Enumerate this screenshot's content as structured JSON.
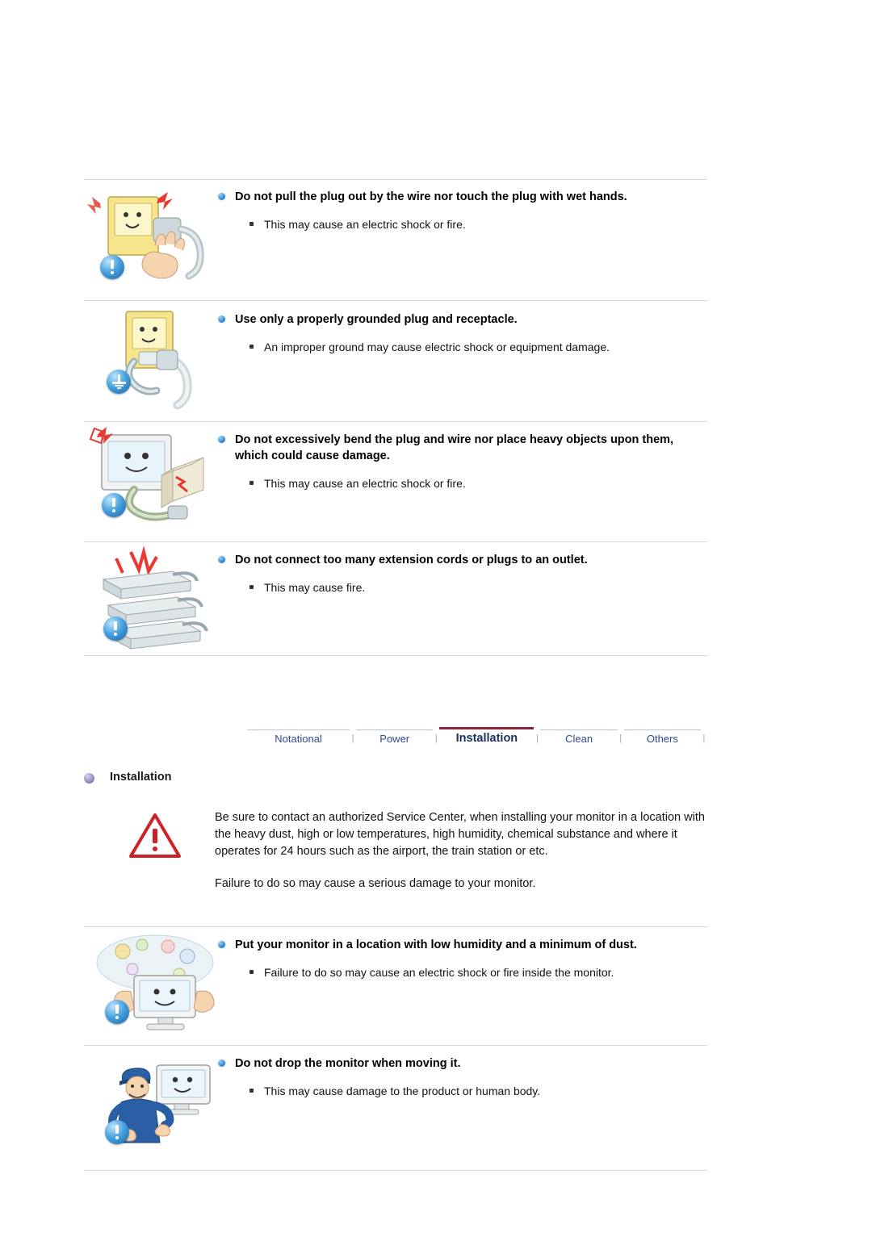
{
  "document": {
    "title": "Safety Instructions - Power / Installation",
    "icons": {
      "warning": "exclamation-circle-icon",
      "ground": "ground-symbol-icon",
      "triangle": "warning-triangle-icon",
      "bullet": "blue-bullet-icon",
      "section_bullet": "purple-bullet-icon"
    }
  },
  "power_items": [
    {
      "heading": "Do not pull the plug out by the wire nor touch the plug with wet hands.",
      "bullets": [
        "This may cause an electric shock or fire."
      ],
      "art": "hand-pulling-plug-illustration",
      "icon": "exclamation-circle-icon"
    },
    {
      "heading": "Use only a properly grounded plug and receptacle.",
      "bullets": [
        "An improper ground may cause electric shock or equipment damage."
      ],
      "art": "grounded-plug-illustration",
      "icon": "ground-symbol-icon"
    },
    {
      "heading": "Do not excessively bend the plug and wire nor place heavy objects upon them, which could cause damage.",
      "bullets": [
        "This may cause an electric shock or fire."
      ],
      "art": "bent-wire-monitor-illustration",
      "icon": "exclamation-circle-icon"
    },
    {
      "heading": "Do not connect too many extension cords or plugs to an outlet.",
      "bullets": [
        "This may cause fire."
      ],
      "art": "overloaded-extension-cords-illustration",
      "icon": "exclamation-circle-icon"
    }
  ],
  "tabs": [
    {
      "label": "Notational",
      "active": false
    },
    {
      "label": "Power",
      "active": false
    },
    {
      "label": "Installation",
      "active": true
    },
    {
      "label": "Clean",
      "active": false
    },
    {
      "label": "Others",
      "active": false
    }
  ],
  "tab_separator": "|",
  "installation": {
    "section_title": "Installation",
    "intro_paragraph": "Be sure to contact an authorized Service Center, when installing your monitor in a location with the heavy dust, high or low temperatures, high humidity, chemical substance and where it operates for 24 hours such as the airport, the train station or etc.",
    "intro_note": "Failure to do so may cause a serious damage to your monitor.",
    "items": [
      {
        "heading": "Put your monitor in a location with low humidity and a minimum of dust.",
        "bullets": [
          "Failure to do so may cause an electric shock or fire inside the monitor."
        ],
        "art": "dusty-room-monitor-illustration",
        "icon": "exclamation-circle-icon"
      },
      {
        "heading": "Do not drop the monitor when moving it.",
        "bullets": [
          "This may cause damage to the product or human body."
        ],
        "art": "worker-carrying-monitor-illustration",
        "icon": "exclamation-circle-icon"
      }
    ]
  },
  "colors": {
    "rule": "#d9d9d9",
    "tab_text": "#2b4b8f",
    "tab_active_underline": "#8d2334",
    "icon_blue": "#2f86d0",
    "triangle_red": "#cc2027"
  }
}
